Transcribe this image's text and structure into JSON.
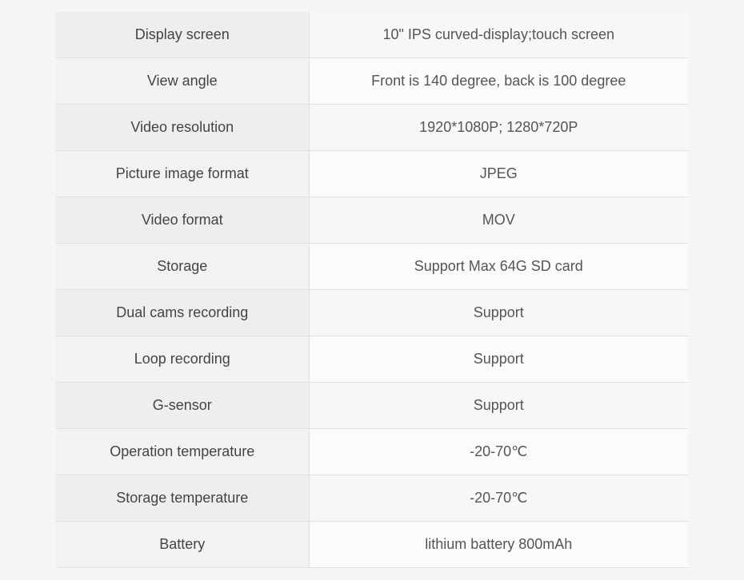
{
  "table": {
    "rows": [
      {
        "label": "Display screen",
        "value": "10\" IPS curved-display;touch screen"
      },
      {
        "label": "View angle",
        "value": "Front is 140 degree, back is 100 degree"
      },
      {
        "label": "Video resolution",
        "value": "1920*1080P; 1280*720P"
      },
      {
        "label": "Picture image format",
        "value": "JPEG"
      },
      {
        "label": "Video format",
        "value": "MOV"
      },
      {
        "label": "Storage",
        "value": "Support Max 64G SD card"
      },
      {
        "label": "Dual cams recording",
        "value": "Support"
      },
      {
        "label": "Loop recording",
        "value": "Support"
      },
      {
        "label": "G-sensor",
        "value": "Support"
      },
      {
        "label": "Operation temperature",
        "value": "-20-70℃"
      },
      {
        "label": "Storage temperature",
        "value": "-20-70℃"
      },
      {
        "label": "Battery",
        "value": "lithium battery 800mAh"
      }
    ]
  }
}
